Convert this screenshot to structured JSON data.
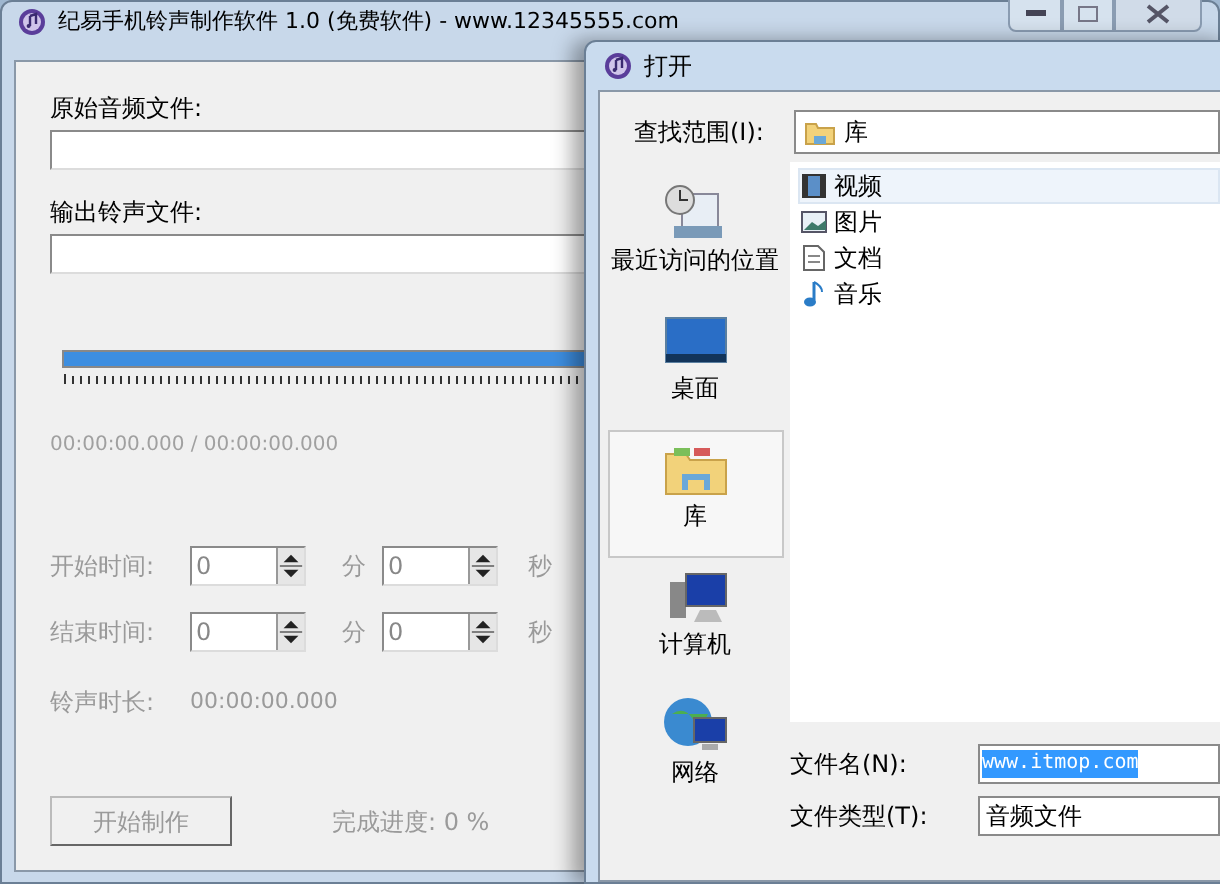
{
  "main_window": {
    "title": "纪易手机铃声制作软件 1.0 (免费软件) - www.12345555.com",
    "original_file": {
      "label": "原始音频文件:"
    },
    "output_file": {
      "label": "输出铃声文件:"
    },
    "position_slider": {
      "level": 1
    },
    "time_readout": "00:00:00.000 / 00:00:00.000",
    "time_rows": [
      {
        "label": "开始时间:",
        "minutes": "0",
        "minutes_unit": "分",
        "seconds": "0",
        "seconds_unit": "秒",
        "disabled": true
      },
      {
        "label": "结束时间:",
        "minutes": "0",
        "minutes_unit": "分",
        "seconds": "0",
        "seconds_unit": "秒",
        "disabled": true
      }
    ],
    "duration": {
      "label": "铃声时长:",
      "value": "00:00:00.000",
      "disabled": true
    },
    "start_button": {
      "label": "开始制作",
      "disabled": true
    },
    "progress_label": "完成进度: 0 %"
  },
  "dialog": {
    "title": "打开",
    "look_in": {
      "label": "查找范围(I):",
      "value": "库"
    },
    "places": [
      {
        "label": "最近访问的位置",
        "kind": "recent",
        "selected": false
      },
      {
        "label": "桌面",
        "kind": "desktop",
        "selected": false
      },
      {
        "label": "库",
        "kind": "library",
        "selected": true
      },
      {
        "label": "计算机",
        "kind": "computer",
        "selected": false
      },
      {
        "label": "网络",
        "kind": "network",
        "selected": false
      }
    ],
    "files": [
      {
        "name": "视频",
        "kind": "video",
        "selected": true
      },
      {
        "name": "图片",
        "kind": "picture",
        "selected": false
      },
      {
        "name": "文档",
        "kind": "document",
        "selected": false
      },
      {
        "name": "音乐",
        "kind": "music",
        "selected": false
      }
    ],
    "file_name": {
      "label": "文件名(N):",
      "value": "www.itmop.com"
    },
    "file_type": {
      "label": "文件类型(T):",
      "value": "音频文件"
    }
  }
}
